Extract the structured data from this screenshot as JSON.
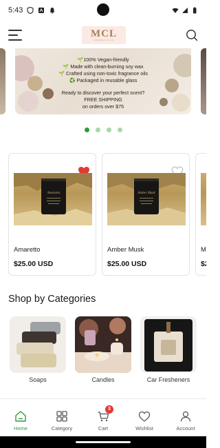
{
  "status_bar": {
    "time": "5:43"
  },
  "header": {
    "logo_text": "MCL",
    "logo_subtext": "candles & co"
  },
  "banner": {
    "lines": [
      "🌱100% Vegan-friendly",
      "🌱 Made with clean-burning soy wax",
      "🌱 Crafted using non-toxic fragrance oils",
      "♻️ Packaged in reusable glass"
    ],
    "cta": "Ready to discover your perfect scent?",
    "shipping_line1": "FREE SHIPPING",
    "shipping_line2": "on orders over $75"
  },
  "carousel": {
    "pages": 4,
    "active_index": 0
  },
  "products": [
    {
      "name": "Amaretto",
      "price": "$25.00 USD",
      "favorited": true
    },
    {
      "name": "Amber Musk",
      "price": "$25.00 USD",
      "favorited": false
    },
    {
      "name": "M",
      "price": "$2",
      "favorited": false
    }
  ],
  "categories_section": {
    "title": "Shop by Categories",
    "items": [
      {
        "label": "Soaps"
      },
      {
        "label": "Candles"
      },
      {
        "label": "Car Fresheners"
      }
    ]
  },
  "bottom_nav": {
    "items": [
      {
        "label": "Home",
        "icon": "home-icon"
      },
      {
        "label": "Category",
        "icon": "grid-icon"
      },
      {
        "label": "Cart",
        "icon": "cart-icon"
      },
      {
        "label": "Wishlist",
        "icon": "heart-icon"
      },
      {
        "label": "Account",
        "icon": "person-icon"
      }
    ],
    "active": "Home",
    "cart_count": "3"
  },
  "colors": {
    "accent": "#2e9b3c",
    "favorite": "#e53935",
    "badge": "#e53935"
  }
}
